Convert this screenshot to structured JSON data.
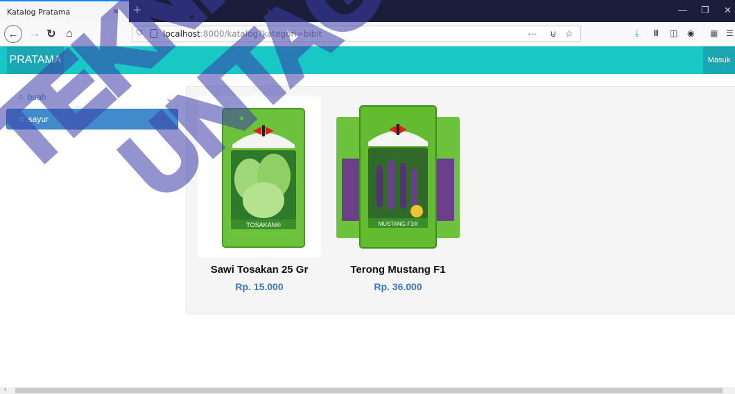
{
  "browser": {
    "tab_title": "Katalog Pratama",
    "tab_close": "×",
    "new_tab": "+",
    "url_host": "localhost",
    "url_rest": ":8000/katalog?kategori=bibit",
    "page_actions": "···",
    "icons": [
      "back-icon",
      "forward-icon",
      "reload-icon",
      "home-icon",
      "shield-icon",
      "page-icon",
      "pocket-icon",
      "bookmark-star-icon",
      "download-icon",
      "library-icon",
      "sidebar-icon",
      "account-icon",
      "extension-icon",
      "menu-icon"
    ]
  },
  "app": {
    "brand": "PRATAMA",
    "login": "Masuk",
    "accent": "#17c8c4",
    "accent_dark": "#1aa6b2"
  },
  "sidebar": {
    "items": [
      {
        "label": "buah",
        "active": false
      },
      {
        "label": "sayur",
        "active": true
      }
    ]
  },
  "products": [
    {
      "name": "Sawi Tosakan 25 Gr",
      "price": "Rp. 15.000",
      "pack_label": "TOSAKAN®"
    },
    {
      "name": "Terong Mustang F1",
      "price": "Rp. 36.000",
      "pack_label": "MUSTANG F1®"
    }
  ],
  "watermark": {
    "line1": "TEKNIK",
    "line2": "UNTAG"
  }
}
